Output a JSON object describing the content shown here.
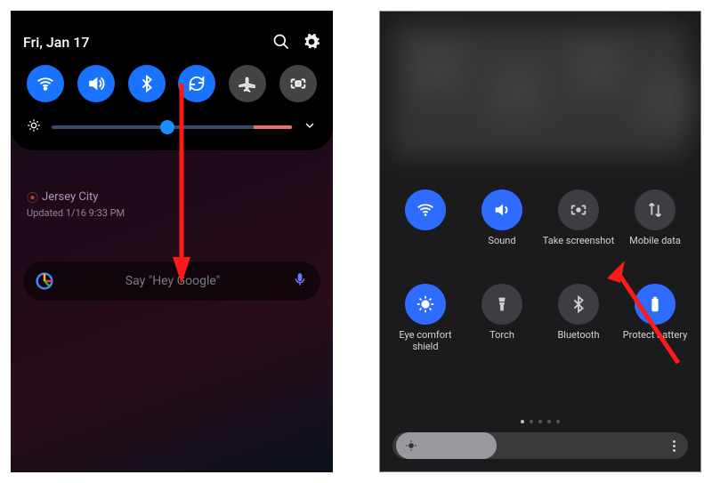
{
  "left_panel": {
    "date": "Fri, Jan 17",
    "header_icons": {
      "search": "search-icon",
      "settings": "gear-icon"
    },
    "tiles": [
      {
        "name": "wifi",
        "active": true
      },
      {
        "name": "sound",
        "active": true
      },
      {
        "name": "bluetooth",
        "active": true
      },
      {
        "name": "autorotate",
        "active": true
      },
      {
        "name": "airplane",
        "active": false
      },
      {
        "name": "screenshot",
        "active": false
      }
    ],
    "brightness_percent": 48,
    "weather": {
      "location": "Jersey City",
      "updated": "Updated 1/16 9:33 PM"
    },
    "google_bar": {
      "placeholder": "Say \"Hey Google\""
    }
  },
  "right_panel": {
    "tiles": [
      {
        "name": "wifi",
        "label": "",
        "active": true
      },
      {
        "name": "sound",
        "label": "Sound",
        "active": true
      },
      {
        "name": "take-screenshot",
        "label": "Take screenshot",
        "active": false
      },
      {
        "name": "mobile-data",
        "label": "Mobile data",
        "active": false
      },
      {
        "name": "eye-comfort",
        "label": "Eye comfort shield",
        "active": true
      },
      {
        "name": "torch",
        "label": "Torch",
        "active": false
      },
      {
        "name": "bluetooth",
        "label": "Bluetooth",
        "active": false
      },
      {
        "name": "protect-battery",
        "label": "Protect battery",
        "active": true
      }
    ],
    "page_dots": {
      "count": 5,
      "active_index": 0
    },
    "brightness_percent": 35
  },
  "accent": "#1a73ff"
}
